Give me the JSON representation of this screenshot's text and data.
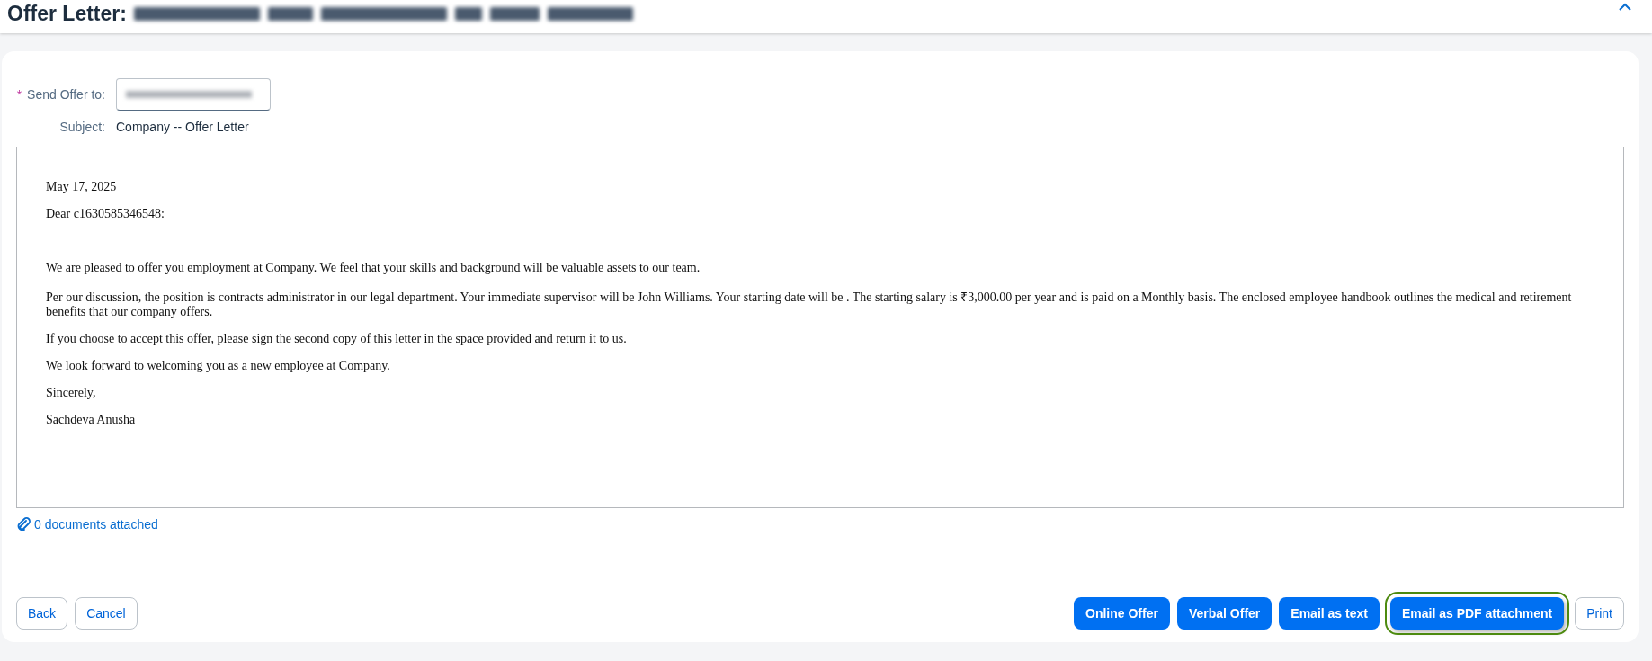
{
  "header": {
    "title": "Offer Letter:"
  },
  "form": {
    "send_to_label": "Send Offer to:",
    "required_marker": "*",
    "subject_label": "Subject:",
    "subject_value": "Company -- Offer Letter"
  },
  "letter": {
    "opening": [
      "May 17, 2025",
      "Dear c1630585346548:"
    ],
    "body": [
      "We are pleased to offer you employment at Company. We feel that your skills and background will be valuable assets to our team.",
      "Per our discussion, the position is contracts administrator in our legal department. Your immediate supervisor will be John Williams. Your starting date will be . The starting salary is ₹3,000.00 per year and is paid on a Monthly basis. The enclosed employee handbook outlines the medical and retirement benefits that our company offers.",
      "If you choose to accept this offer, please sign the second copy of this letter in the space provided and return it to us.",
      "We look forward to welcoming you as a new employee at Company.",
      "Sincerely,",
      "Sachdeva Anusha"
    ]
  },
  "attachments": {
    "label": "0 documents attached"
  },
  "left_buttons": [
    {
      "label": "Back",
      "kind": "secondary",
      "highlighted": false
    },
    {
      "label": "Cancel",
      "kind": "secondary",
      "highlighted": false
    }
  ],
  "right_buttons": [
    {
      "label": "Online Offer",
      "kind": "primary",
      "highlighted": false
    },
    {
      "label": "Verbal Offer",
      "kind": "primary",
      "highlighted": false
    },
    {
      "label": "Email as text",
      "kind": "primary",
      "highlighted": false
    },
    {
      "label": "Email as PDF attachment",
      "kind": "primary",
      "highlighted": true
    },
    {
      "label": "Print",
      "kind": "secondary",
      "highlighted": false
    }
  ]
}
